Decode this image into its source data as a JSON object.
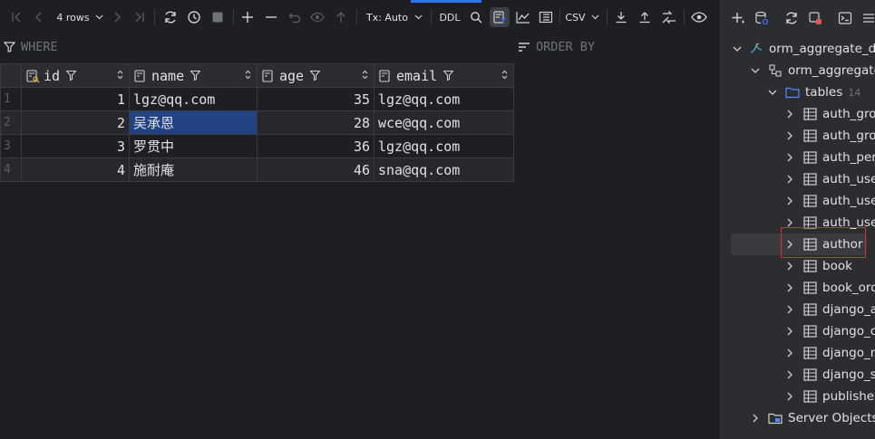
{
  "toolbar": {
    "rows_label": "4 rows",
    "tx_label": "Tx: Auto",
    "ddl_label": "DDL",
    "csv_label": "CSV"
  },
  "filters": {
    "where_label": "WHERE",
    "orderby_label": "ORDER BY"
  },
  "grid": {
    "columns": [
      "id",
      "name",
      "age",
      "email"
    ],
    "rows": [
      {
        "num": "1",
        "id": "1",
        "name": "lgz@qq.com",
        "age": "35",
        "email": "lgz@qq.com"
      },
      {
        "num": "2",
        "id": "2",
        "name": "吴承恩",
        "age": "28",
        "email": "wce@qq.com"
      },
      {
        "num": "3",
        "id": "3",
        "name": "罗贯中",
        "age": "36",
        "email": "lgz@qq.com"
      },
      {
        "num": "4",
        "id": "4",
        "name": "施耐庵",
        "age": "46",
        "email": "sna@qq.com"
      }
    ]
  },
  "explorer": {
    "datasource": "orm_aggregate_dem",
    "schema": "orm_aggregate_",
    "tables_label": "tables",
    "tables_count": "14",
    "tables": [
      "auth_grou",
      "auth_grou",
      "auth_perm",
      "auth_user",
      "auth_user",
      "auth_user",
      "author",
      "book",
      "book_orde",
      "django_ad",
      "django_co",
      "django_m",
      "django_se",
      "publisher"
    ],
    "server_objects": "Server Objects"
  },
  "colors": {
    "background": "#1e1f22",
    "panel": "#2b2d30",
    "selection": "#214283",
    "highlight_box": "#e02b2b",
    "accent_blue": "#3574f0"
  }
}
